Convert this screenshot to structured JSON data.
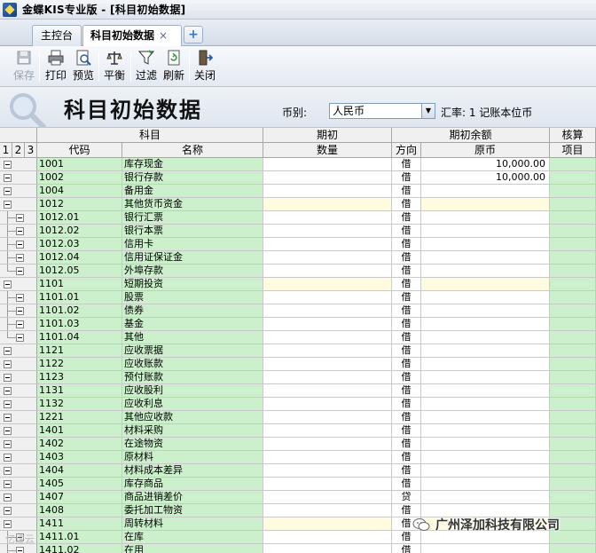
{
  "window": {
    "title": "金蝶KIS专业版 - [科目初始数据]"
  },
  "tabs": [
    {
      "label": "主控台"
    },
    {
      "label": "科目初始数据",
      "close": "×"
    }
  ],
  "tab_add_label": "+",
  "toolbar": {
    "save": "保存",
    "print": "打印",
    "preview": "预览",
    "balance": "平衡",
    "filter": "过滤",
    "refresh": "刷新",
    "close": "关闭"
  },
  "header": {
    "title": "科目初始数据",
    "currency_label": "币别:",
    "currency_value": "人民币",
    "rate_text": "汇率: 1 记账本位币"
  },
  "grid": {
    "levels": [
      "1",
      "2",
      "3"
    ],
    "group_subject": "科目",
    "group_opening": "期初",
    "group_opening_balance": "期初余额",
    "group_audit": "核算",
    "col_code": "代码",
    "col_name": "名称",
    "col_qty": "数量",
    "col_direction": "方向",
    "col_original": "原币",
    "col_item": "项目",
    "rows": [
      {
        "code": "1001",
        "name": "库存现金",
        "dir": "借",
        "orig": "10,000.00",
        "level": 1,
        "parent": false
      },
      {
        "code": "1002",
        "name": "银行存款",
        "dir": "借",
        "orig": "10,000.00",
        "level": 1,
        "parent": false
      },
      {
        "code": "1004",
        "name": "备用金",
        "dir": "借",
        "orig": "",
        "level": 1,
        "parent": false
      },
      {
        "code": "1012",
        "name": "其他货币资金",
        "dir": "借",
        "orig": "",
        "level": 1,
        "parent": true
      },
      {
        "code": "1012.01",
        "name": "银行汇票",
        "dir": "借",
        "orig": "",
        "level": 2,
        "parent": false
      },
      {
        "code": "1012.02",
        "name": "银行本票",
        "dir": "借",
        "orig": "",
        "level": 2,
        "parent": false
      },
      {
        "code": "1012.03",
        "name": "信用卡",
        "dir": "借",
        "orig": "",
        "level": 2,
        "parent": false
      },
      {
        "code": "1012.04",
        "name": "信用证保证金",
        "dir": "借",
        "orig": "",
        "level": 2,
        "parent": false
      },
      {
        "code": "1012.05",
        "name": "外埠存款",
        "dir": "借",
        "orig": "",
        "level": 2,
        "parent": false,
        "last": true
      },
      {
        "code": "1101",
        "name": "短期投资",
        "dir": "借",
        "orig": "",
        "level": 1,
        "parent": true
      },
      {
        "code": "1101.01",
        "name": "股票",
        "dir": "借",
        "orig": "",
        "level": 2,
        "parent": false
      },
      {
        "code": "1101.02",
        "name": "债券",
        "dir": "借",
        "orig": "",
        "level": 2,
        "parent": false
      },
      {
        "code": "1101.03",
        "name": "基金",
        "dir": "借",
        "orig": "",
        "level": 2,
        "parent": false
      },
      {
        "code": "1101.04",
        "name": "其他",
        "dir": "借",
        "orig": "",
        "level": 2,
        "parent": false,
        "last": true
      },
      {
        "code": "1121",
        "name": "应收票据",
        "dir": "借",
        "orig": "",
        "level": 1,
        "parent": false
      },
      {
        "code": "1122",
        "name": "应收账款",
        "dir": "借",
        "orig": "",
        "level": 1,
        "parent": false
      },
      {
        "code": "1123",
        "name": "预付账款",
        "dir": "借",
        "orig": "",
        "level": 1,
        "parent": false
      },
      {
        "code": "1131",
        "name": "应收股利",
        "dir": "借",
        "orig": "",
        "level": 1,
        "parent": false
      },
      {
        "code": "1132",
        "name": "应收利息",
        "dir": "借",
        "orig": "",
        "level": 1,
        "parent": false
      },
      {
        "code": "1221",
        "name": "其他应收款",
        "dir": "借",
        "orig": "",
        "level": 1,
        "parent": false
      },
      {
        "code": "1401",
        "name": "材料采购",
        "dir": "借",
        "orig": "",
        "level": 1,
        "parent": false
      },
      {
        "code": "1402",
        "name": "在途物资",
        "dir": "借",
        "orig": "",
        "level": 1,
        "parent": false
      },
      {
        "code": "1403",
        "name": "原材料",
        "dir": "借",
        "orig": "",
        "level": 1,
        "parent": false
      },
      {
        "code": "1404",
        "name": "材料成本差异",
        "dir": "借",
        "orig": "",
        "level": 1,
        "parent": false
      },
      {
        "code": "1405",
        "name": "库存商品",
        "dir": "借",
        "orig": "",
        "level": 1,
        "parent": false
      },
      {
        "code": "1407",
        "name": "商品进销差价",
        "dir": "贷",
        "orig": "",
        "level": 1,
        "parent": false
      },
      {
        "code": "1408",
        "name": "委托加工物资",
        "dir": "借",
        "orig": "",
        "level": 1,
        "parent": false
      },
      {
        "code": "1411",
        "name": "周转材料",
        "dir": "借",
        "orig": "",
        "level": 1,
        "parent": true
      },
      {
        "code": "1411.01",
        "name": "在库",
        "dir": "借",
        "orig": "",
        "level": 2,
        "parent": false
      },
      {
        "code": "1411.02",
        "name": "在用",
        "dir": "借",
        "orig": "",
        "level": 2,
        "parent": false
      }
    ]
  },
  "watermark": {
    "text": "广州泽加科技有限公司",
    "icon": "wechat-icon"
  },
  "watermark2": {
    "text": "亿速云"
  }
}
